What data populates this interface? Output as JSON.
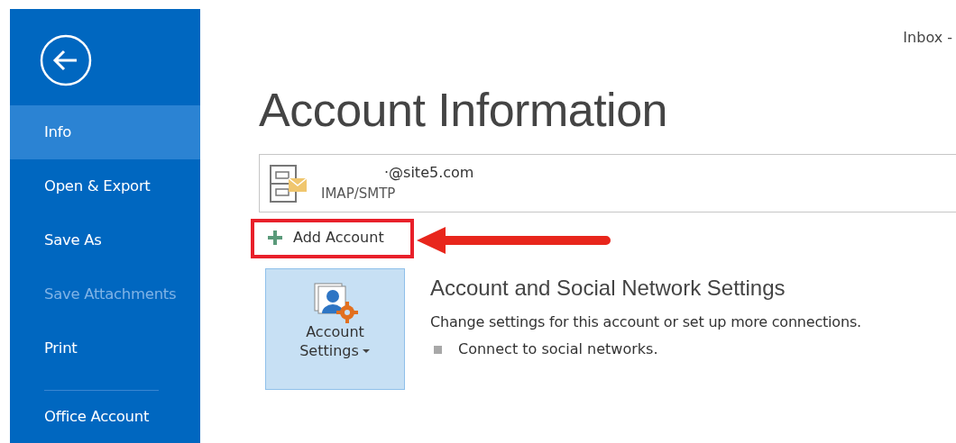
{
  "window": {
    "title": "Inbox -"
  },
  "sidebar": {
    "items": [
      {
        "label": "Info",
        "selected": true,
        "disabled": false
      },
      {
        "label": "Open & Export",
        "selected": false,
        "disabled": false
      },
      {
        "label": "Save As",
        "selected": false,
        "disabled": false
      },
      {
        "label": "Save Attachments",
        "selected": false,
        "disabled": true
      },
      {
        "label": "Print",
        "selected": false,
        "disabled": false
      },
      {
        "label": "Office Account",
        "selected": false,
        "disabled": false
      }
    ]
  },
  "page_title": "Account Information",
  "account": {
    "email": "·@site5.com",
    "type": "IMAP/SMTP"
  },
  "add_account": {
    "label": "Add Account",
    "highlighted": true
  },
  "settings": {
    "button": {
      "line_1": "Account",
      "line_2": "Settings"
    },
    "heading": "Account and Social Network Settings",
    "description": "Change settings for this account or set up more connections.",
    "bullets": [
      "Connect to social networks."
    ]
  }
}
